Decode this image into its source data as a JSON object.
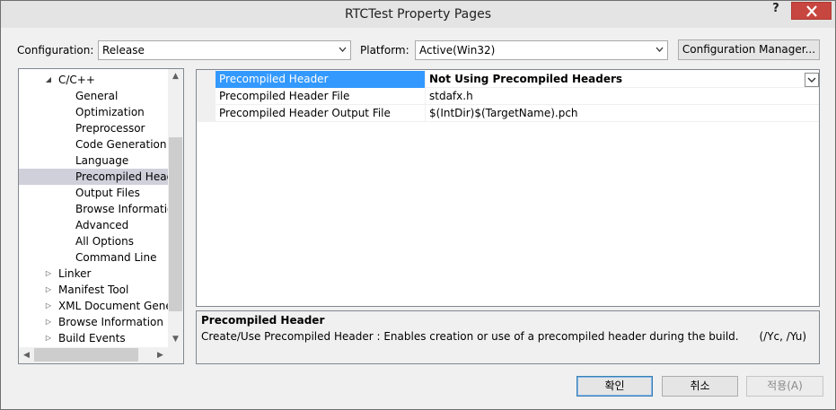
{
  "window": {
    "title": "RTCTest Property Pages",
    "help": "?"
  },
  "toolbar": {
    "configuration_label": "Configuration:",
    "configuration_value": "Release",
    "platform_label": "Platform:",
    "platform_value": "Active(Win32)",
    "config_manager_label": "Configuration Manager..."
  },
  "tree": {
    "items": [
      {
        "label": "C/C++",
        "expander": "◢"
      },
      {
        "label": "General"
      },
      {
        "label": "Optimization"
      },
      {
        "label": "Preprocessor"
      },
      {
        "label": "Code Generation"
      },
      {
        "label": "Language"
      },
      {
        "label": "Precompiled Header"
      },
      {
        "label": "Output Files"
      },
      {
        "label": "Browse Information"
      },
      {
        "label": "Advanced"
      },
      {
        "label": "All Options"
      },
      {
        "label": "Command Line"
      },
      {
        "label": "Linker",
        "expander": "▷"
      },
      {
        "label": "Manifest Tool",
        "expander": "▷"
      },
      {
        "label": "XML Document Generator",
        "expander": "▷"
      },
      {
        "label": "Browse Information",
        "expander": "▷"
      },
      {
        "label": "Build Events",
        "expander": "▷"
      }
    ]
  },
  "grid": {
    "rows": [
      {
        "name": "Precompiled Header",
        "value": "Not Using Precompiled Headers"
      },
      {
        "name": "Precompiled Header File",
        "value": "stdafx.h"
      },
      {
        "name": "Precompiled Header Output File",
        "value": "$(IntDir)$(TargetName).pch"
      }
    ]
  },
  "description": {
    "title": "Precompiled Header",
    "text": "Create/Use Precompiled Header : Enables creation or use of a precompiled header during the build.      (/Yc, /Yu)"
  },
  "buttons": {
    "ok": "확인",
    "cancel": "취소",
    "apply": "적용(A)"
  },
  "colors": {
    "selection": "#3399ff",
    "tree_selection": "#cfd0da",
    "close_button": "#c7463f"
  }
}
